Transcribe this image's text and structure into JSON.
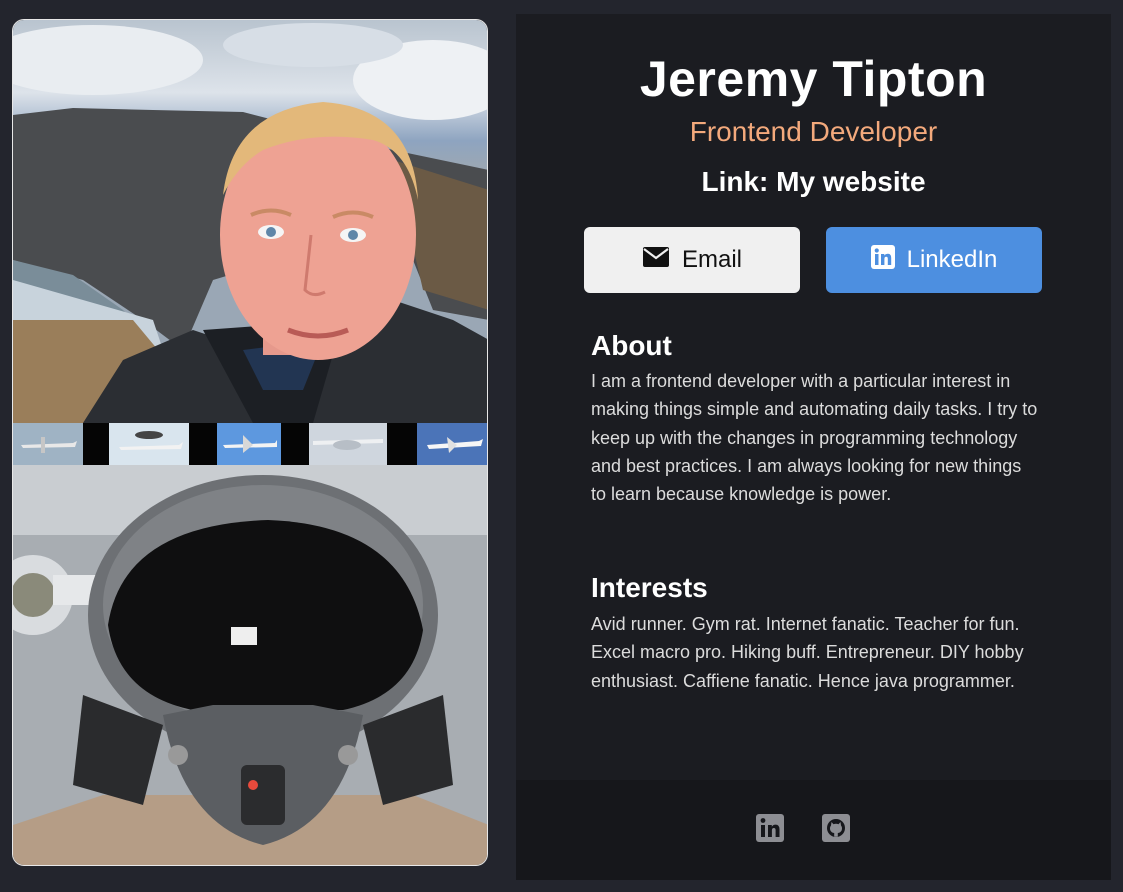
{
  "profile": {
    "name": "Jeremy Tipton",
    "role": "Frontend Developer",
    "link_text": "Link: My website"
  },
  "buttons": {
    "email_label": "Email",
    "linkedin_label": "LinkedIn"
  },
  "about": {
    "title": "About",
    "text": "I am a frontend developer with a particular interest in making things simple and automating daily tasks. I try to keep up with the changes in programming technology and best practices. I am always looking for new things to learn because knowledge is power."
  },
  "interests": {
    "title": "Interests",
    "text": "Avid runner. Gym rat. Internet fanatic. Teacher for fun. Excel macro pro. Hiking buff. Entrepreneur. DIY hobby enthusiast. Caffiene fanatic. Hence java programmer."
  },
  "icons": {
    "email": "envelope-icon",
    "linkedin": "linkedin-icon",
    "footer_linkedin": "linkedin-icon",
    "footer_github": "github-icon"
  },
  "colors": {
    "page_background": "#23252d",
    "card_background": "#1b1c21",
    "role_accent": "#f3a97c",
    "linkedin_button": "#4d8fe0",
    "email_button": "#f0f0f0"
  }
}
